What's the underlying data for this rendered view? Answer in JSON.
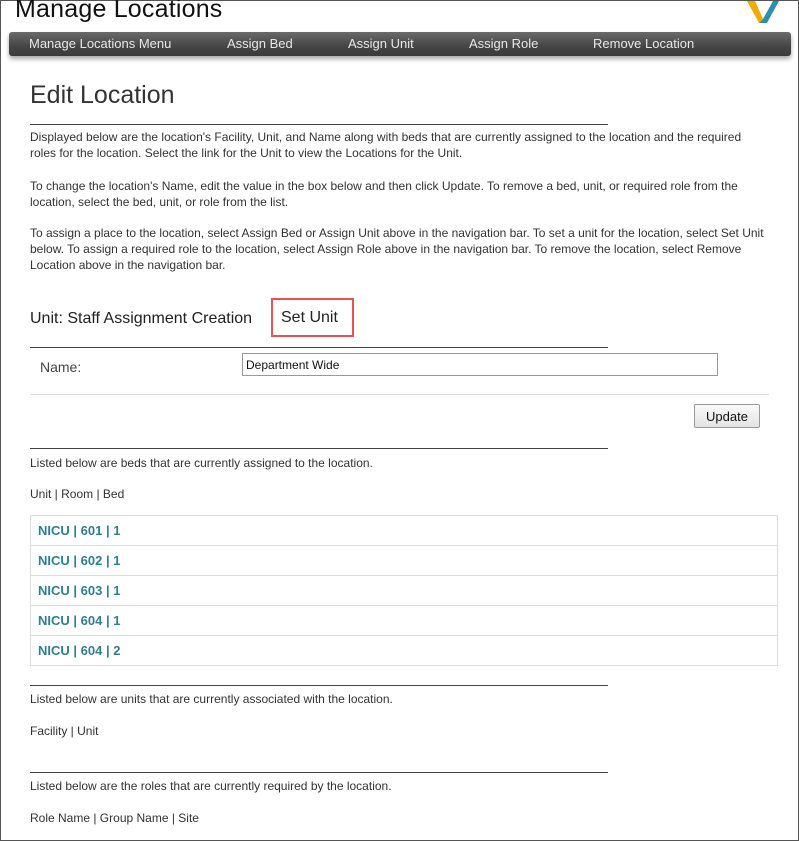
{
  "app": {
    "title": "Manage Locations"
  },
  "nav": {
    "items": [
      {
        "label": "Manage Locations Menu"
      },
      {
        "label": "Assign Bed"
      },
      {
        "label": "Assign Unit"
      },
      {
        "label": "Assign Role"
      },
      {
        "label": "Remove Location"
      }
    ]
  },
  "page": {
    "title": "Edit Location",
    "intro": [
      "Displayed below are the location's Facility, Unit, and Name along with beds that are currently assigned to the location and the required roles for the location. Select the link for the Unit to view the Locations for the Unit.",
      "To change the location's Name, edit the value in the box below and then click Update. To remove a bed, unit, or required role from the location, select the bed, unit, or role from the list.",
      "To assign a place to the location, select Assign Bed or Assign Unit above in the navigation bar. To set a unit for the location, select Set Unit below. To assign a required role to the location, select Assign Role above in the navigation bar. To remove the location, select Remove Location above in the navigation bar."
    ]
  },
  "unit": {
    "label": "Unit: Staff Assignment Creation",
    "set_unit_label": "Set Unit"
  },
  "form": {
    "name_label": "Name:",
    "name_value": "Department Wide",
    "update_label": "Update"
  },
  "beds": {
    "description": "Listed below are beds that are currently assigned to the location.",
    "columns": "Unit | Room | Bed",
    "rows": [
      "NICU | 601 | 1",
      "NICU | 602 | 1",
      "NICU | 603 | 1",
      "NICU | 604 | 1",
      "NICU | 604 | 2"
    ]
  },
  "units": {
    "description": "Listed below are units that are currently associated with the location.",
    "columns": "Facility | Unit"
  },
  "roles": {
    "description": "Listed below are the roles that are currently required by the location.",
    "columns": "Role Name | Group Name | Site"
  },
  "colors": {
    "link": "#2e7f8f",
    "highlight": "#e05555",
    "navbar": "#454545"
  },
  "icons": {
    "logo": "brand-logo-icon"
  }
}
